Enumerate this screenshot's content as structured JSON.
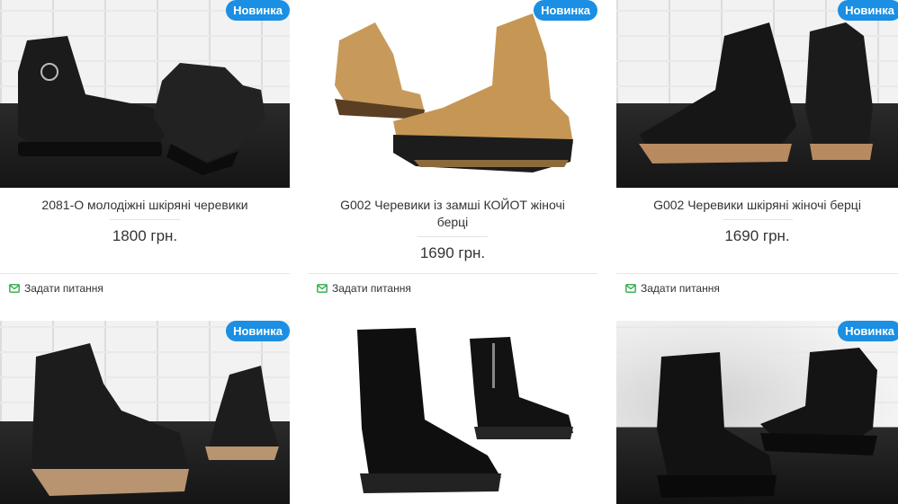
{
  "badge_label": "Новинка",
  "ask_label": "Задати питання",
  "products": [
    {
      "title": "2081-О молодіжні шкіряні черевики",
      "price": "1800 грн."
    },
    {
      "title": "G002 Черевики із замші КОЙОТ жіночі берці",
      "price": "1690 грн."
    },
    {
      "title": "G002 Черевики шкіряні жіночі берці",
      "price": "1690 грн."
    },
    {
      "title": "",
      "price": ""
    },
    {
      "title": "",
      "price": ""
    },
    {
      "title": "",
      "price": ""
    }
  ],
  "colors": {
    "badge": "#1a8fe3",
    "ask_icon": "#2eaa4a"
  }
}
